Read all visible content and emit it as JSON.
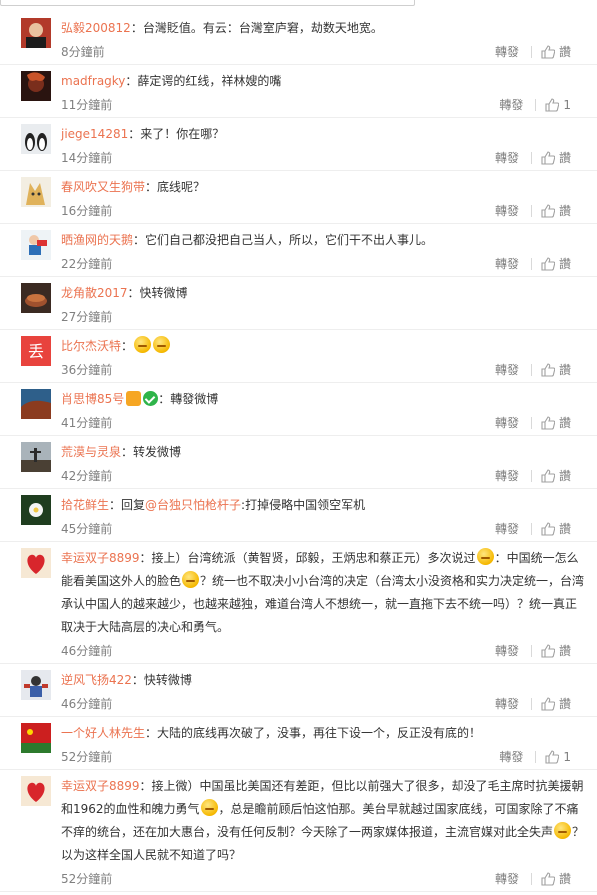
{
  "colors": {
    "username": "#eb7350",
    "time": "#808080",
    "text": "#333333"
  },
  "actions": {
    "repost_label": "轉發",
    "like_label": "讚"
  },
  "comments": [
    {
      "user": "弘毅200812",
      "text": "：台灣貶值。有云：台灣室庐窘，劫数天地宽。",
      "time": "8分鐘前",
      "likes": "讚"
    },
    {
      "user": "madfragky",
      "text": "：薛定谔的红线，祥林嫂的嘴",
      "time": "11分鐘前",
      "likes": "1"
    },
    {
      "user": "jiege14281",
      "text": "：来了！你在哪？",
      "time": "14分鐘前",
      "likes": "讚"
    },
    {
      "user": "春风吹又生狗带",
      "text": "：底线呢？",
      "time": "16分鐘前",
      "likes": "讚"
    },
    {
      "user": "晒渔网的天鹅",
      "text": "：它们自己都没把自己当人，所以，它们干不出人事儿。",
      "time": "22分鐘前",
      "likes": "讚"
    },
    {
      "user": "龙角散2017",
      "text": "：快转微博",
      "time": "27分鐘前",
      "likes": ""
    },
    {
      "user": "比尔杰沃特",
      "text": "：",
      "time": "36分鐘前",
      "likes": "讚"
    },
    {
      "user": "肖思博85号",
      "text": "：轉發微博",
      "time": "41分鐘前",
      "likes": "讚"
    },
    {
      "user": "荒漠与灵泉",
      "text": "：转发微博",
      "time": "42分鐘前",
      "likes": "讚"
    },
    {
      "user": "拾花鲜生",
      "text_pre": "：回复",
      "mention": "@台独只怕枪杆子",
      "text": ":打掉侵略中国领空军机",
      "time": "45分鐘前",
      "likes": "讚"
    },
    {
      "user": "幸运双子8899",
      "text_1": "：接上）台湾统派（黄智贤，邱毅，王炳忠和蔡正元）多次说过",
      "text_2": "：中国统一怎么能看美国这外人的脸色",
      "text_3": "？统一也不取决小小台湾的决定（台湾太小没资格和实力决定统一，台湾承认中国人的越来越少，也越来越独，难道台湾人不想统一，就一直拖下去不统一吗）？统一真正取决于大陆高层的决心和勇气。",
      "time": "46分鐘前",
      "likes": "讚"
    },
    {
      "user": "逆风飞扬422",
      "text": "：快转微博",
      "time": "46分鐘前",
      "likes": "讚"
    },
    {
      "user": "一个好人林先生",
      "text": "：大陆的底线再次破了，没事，再往下设一个，反正没有底的！",
      "time": "52分鐘前",
      "likes": "1"
    },
    {
      "user": "幸运双子8899",
      "text_1": "：接上微）中国虽比美国还有差距，但比以前强大了很多，却没了毛主席时抗美援朝和1962的血性和魄力勇气",
      "text_2": "，总是瞻前顾后怕这怕那。美台早就越过国家底线，可国家除了不痛不痒的统台，还在加大惠台，没有任何反制？今天除了一两家媒体报道，主流官媒对此全失声",
      "text_3": "？以为这样全国人民就不知道了吗？",
      "time": "52分鐘前",
      "likes": "讚"
    }
  ]
}
